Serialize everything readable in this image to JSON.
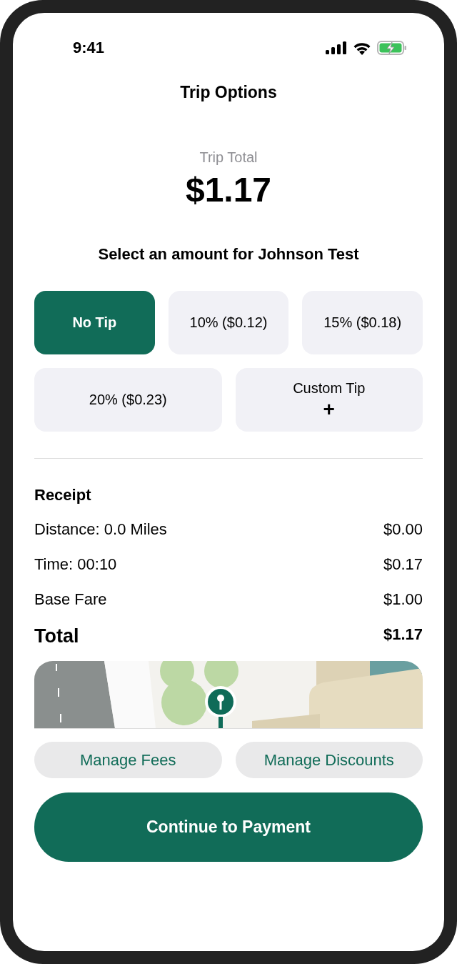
{
  "status_bar": {
    "time": "9:41"
  },
  "header": {
    "title": "Trip Options"
  },
  "total": {
    "label": "Trip Total",
    "amount": "$1.17"
  },
  "tip_prompt": "Select an amount for Johnson Test",
  "tip_rows": [
    [
      {
        "label": "No Tip",
        "selected": true
      },
      {
        "label": "10% ($0.12)",
        "selected": false
      },
      {
        "label": "15% ($0.18)",
        "selected": false
      }
    ],
    [
      {
        "label": "20% ($0.23)",
        "selected": false
      },
      {
        "label": "Custom Tip",
        "symbol": "+",
        "selected": false
      }
    ]
  ],
  "receipt": {
    "title": "Receipt",
    "rows": [
      {
        "label": "Distance: 0.0 Miles",
        "value": "$0.00"
      },
      {
        "label": "Time: 00:10",
        "value": "$0.17"
      },
      {
        "label": "Base Fare",
        "value": "$1.00"
      }
    ],
    "total": {
      "label": "Total",
      "value": "$1.17"
    }
  },
  "map": {
    "kind": "picture"
  },
  "actions": [
    "Manage Fees",
    "Manage Discounts"
  ],
  "primary_button": "Continue to Payment"
}
